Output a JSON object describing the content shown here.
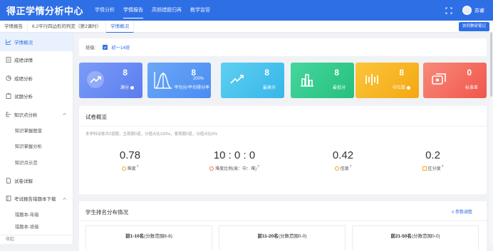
{
  "header": {
    "brand": "得正学情分析中心",
    "nav": [
      "学情分析",
      "学情报告",
      "高频错题归再",
      "教学监管"
    ],
    "user": "苏睿"
  },
  "crumbs": [
    "学情报告",
    "6.2平行四边形的判定（第2课时）",
    "学情概况"
  ],
  "crumb_button": "协同教研笔记",
  "sidebar": {
    "items": [
      "学情概况",
      "成绩详情",
      "成绩分析",
      "试题分析",
      "知识点分析",
      "知识掌握图谱",
      "知识掌握分析",
      "知识点示范",
      "试卷详解",
      "考试报告错题本下载",
      "错题本-年级",
      "错题本-班级"
    ],
    "footer": "收起"
  },
  "class_filter": {
    "label": "班级:",
    "value": "初一14班"
  },
  "stats": [
    {
      "value": "8",
      "sub": "",
      "label": "满分",
      "color": "#6b8cf5",
      "icon": "trend-up-icon"
    },
    {
      "value": "8",
      "sub": "100%",
      "label": "平均分/平均得分率",
      "color": "#5b9af5",
      "icon": "bell-curve-icon"
    },
    {
      "value": "8",
      "sub": "",
      "label": "最高分",
      "color": "#3fc1ea",
      "icon": "trend-up-icon"
    },
    {
      "value": "8",
      "sub": "",
      "label": "最低分",
      "color": "#2fc98a",
      "icon": "bar-chart-icon"
    },
    {
      "value": "8",
      "sub": "",
      "label": "中位数",
      "color": "#f7b520",
      "icon": "median-icon"
    },
    {
      "value": "0",
      "sub": "",
      "label": "标准差",
      "color": "#f46c62",
      "icon": "variance-icon"
    }
  ],
  "overview": {
    "title": "试卷概览",
    "desc": "本学科试卷共2道题，主观题0道，分值占比100%，客观题0道，分值占比0%",
    "metrics": [
      {
        "value": "0.78",
        "label": "难度"
      },
      {
        "value": "10 : 0 : 0",
        "label": "难度比例(易：中：难)"
      },
      {
        "value": "0.42",
        "label": "信度"
      },
      {
        "value": "0.2",
        "label": "区分度"
      }
    ]
  },
  "ranking": {
    "title": "学生排名分布情况",
    "link": "参数调整",
    "boxes": [
      {
        "name": "前1-10名",
        "range": "(分数范围8-8)"
      },
      {
        "name": "前11-20名",
        "range": "(分数范围0-0)"
      },
      {
        "name": "前21-50名",
        "range": "(分数范围0-0)"
      }
    ]
  }
}
